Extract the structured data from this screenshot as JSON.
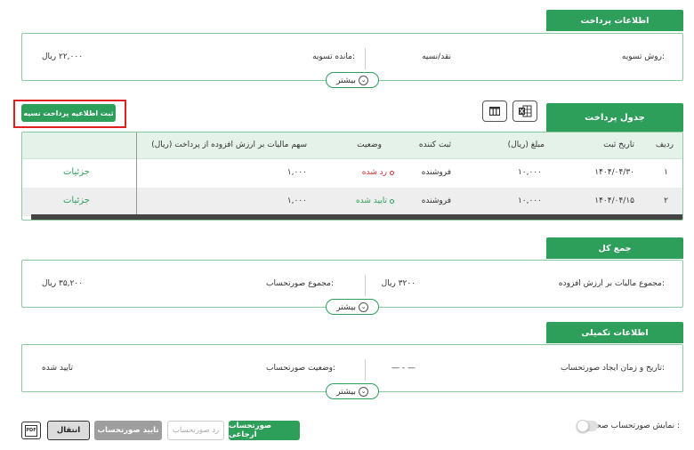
{
  "payment_info": {
    "title": "اطلاعات پرداخت",
    "method_label": "روش تسویه:",
    "method_value": "نقد/نسیه",
    "balance_label": "مانده تسویه:",
    "balance_value": "۲۲,۰۰۰ ریال",
    "more_label": "بیشتر"
  },
  "payment_table": {
    "title": "جدول پرداخت",
    "add_button": "ثبت اطلاعیه پرداخت نسیه",
    "columns": [
      "ردیف",
      "تاریخ ثبت",
      "مبلغ (ریال)",
      "ثبت کننده",
      "وضعیت",
      "سهم مالیات بر ارزش افزوده از پرداخت (ریال)"
    ],
    "rows": [
      {
        "index": "۱",
        "date": "۱۴۰۴/۰۴/۳۰",
        "amount": "۱۰,۰۰۰",
        "registrar": "فروشنده",
        "status": "رد شده",
        "status_color": "#d32f2f",
        "tax": "۱,۰۰۰",
        "action": "جزئیات"
      },
      {
        "index": "۲",
        "date": "۱۴۰۴/۰۴/۱۵",
        "amount": "۱۰,۰۰۰",
        "registrar": "فروشنده",
        "status": "تایید شده",
        "status_color": "#2e9e5b",
        "tax": "۱,۰۰۰",
        "action": "جزئیات"
      }
    ]
  },
  "total": {
    "title": "جمع کل",
    "vat_label": "مجموع مالیات بر ارزش افزوده:",
    "vat_value": "۳۲۰۰ ریال",
    "invoice_label": "مجموع صورتحساب:",
    "invoice_value": "۳۵,۲۰۰ ریال",
    "more_label": "بیشتر"
  },
  "extra": {
    "title": "اطلاعات تکمیلی",
    "created_label": "تاریخ و زمان ایجاد صورتحساب:",
    "created_value": "— - —",
    "status_label": "وضعیت صورتحساب:",
    "status_value": "تایید شده",
    "more_label": "بیشتر"
  },
  "footer": {
    "toggle_label": "نمایش صورتحساب صحیح :",
    "return_invoice": "صورتحساب ارجاعی",
    "reject_invoice": "رد صورتحساب",
    "approve_invoice": "تایید صورتحساب",
    "transfer": "انتقال",
    "pdf": "PDF"
  },
  "colors": {
    "accent": "#2e9e5b",
    "highlight": "#e02020"
  }
}
